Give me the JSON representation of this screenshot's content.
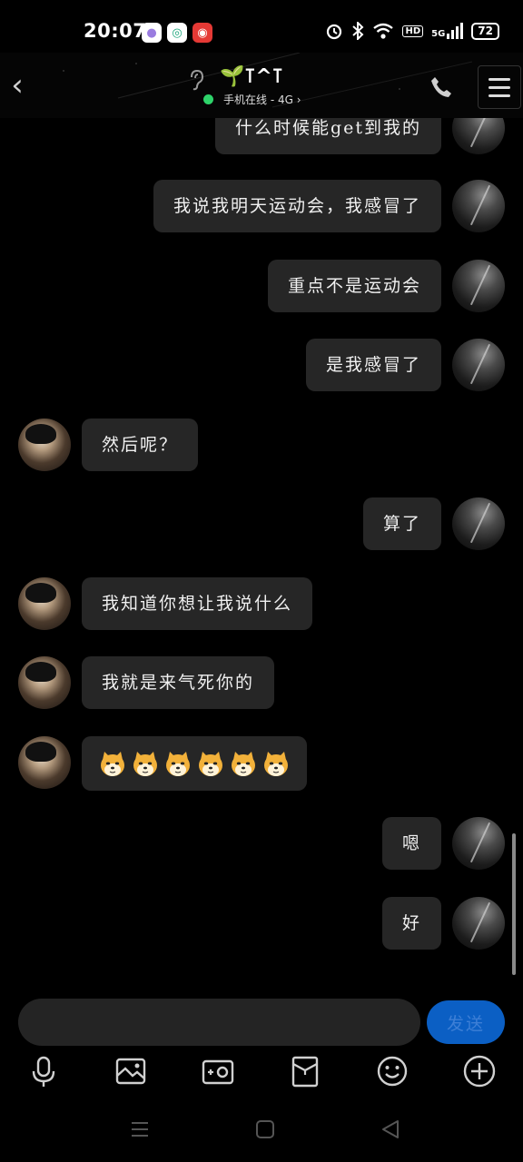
{
  "status_bar": {
    "time": "20:07",
    "battery": "72",
    "network": "5G",
    "hd": "HD"
  },
  "header": {
    "contact_name": "🌱⊺^⊺",
    "online_status": "手机在线 - 4G ›"
  },
  "messages": [
    {
      "side": "out",
      "text": "什么时候能get到我的"
    },
    {
      "side": "out",
      "text": "我说我明天运动会，我感冒了"
    },
    {
      "side": "out",
      "text": "重点不是运动会"
    },
    {
      "side": "out",
      "text": "是我感冒了"
    },
    {
      "side": "in",
      "text": "然后呢？"
    },
    {
      "side": "out",
      "text": "算了"
    },
    {
      "side": "in",
      "text": "我知道你想让我说什么"
    },
    {
      "side": "in",
      "text": "我就是来气死你的"
    },
    {
      "side": "in",
      "text": "",
      "emoji_count": 6
    },
    {
      "side": "out",
      "text": "嗯"
    },
    {
      "side": "out",
      "text": "好"
    }
  ],
  "input": {
    "value": "",
    "send_label": "发送"
  },
  "toolbar": [
    "microphone-icon",
    "image-icon",
    "camera-icon",
    "red-packet-icon",
    "emoji-icon",
    "plus-icon"
  ],
  "nav": [
    "menu-icon",
    "home-icon",
    "back-icon"
  ],
  "colors": {
    "bubble": "#262626",
    "send": "#0b5fc4",
    "online": "#2ed36a"
  }
}
